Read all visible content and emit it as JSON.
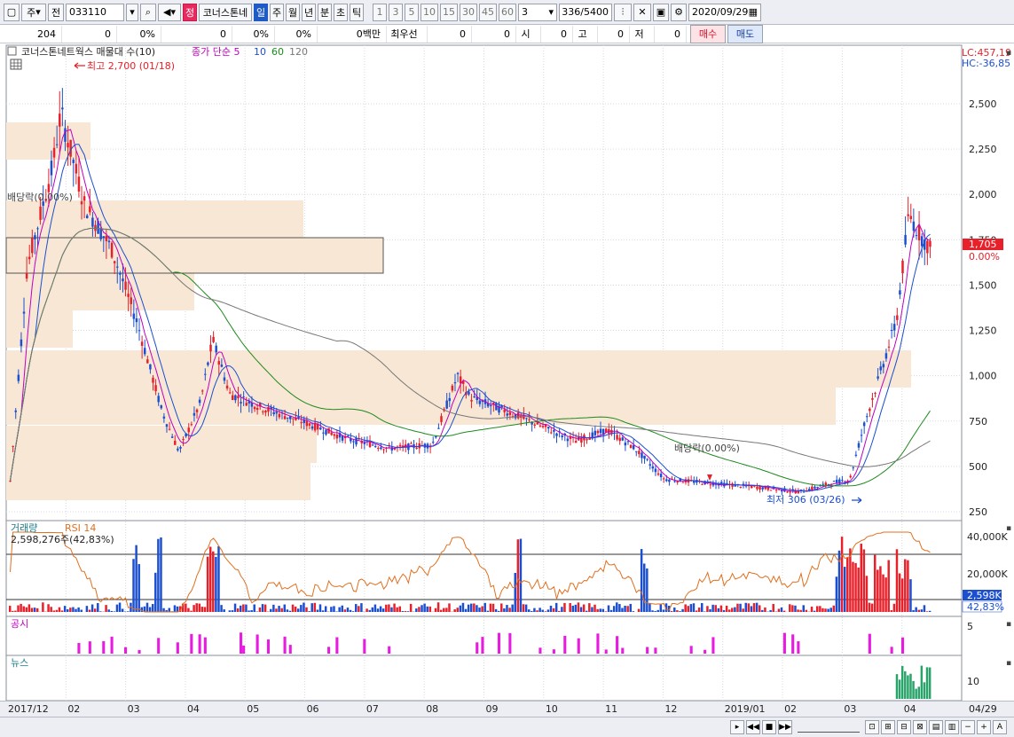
{
  "toolbar": {
    "type": "주",
    "prev": "전",
    "code": "033110",
    "jeong": "정",
    "stock_name": "코너스톤네",
    "periods": [
      "일",
      "주",
      "월",
      "년",
      "분",
      "초",
      "틱"
    ],
    "numbers": [
      "1",
      "3",
      "5",
      "10",
      "15",
      "30",
      "45",
      "60"
    ],
    "interval": "3",
    "count": "336",
    "total": "/5400",
    "date": "2020/09/29"
  },
  "quote": {
    "volume": "204",
    "v2": "0",
    "pct1": "0%",
    "v3": "0",
    "pct2": "0%",
    "pct3": "0%",
    "amount": "0백만",
    "best_label": "최우선",
    "best1": "0",
    "best2": "0",
    "open_label": "시",
    "open": "0",
    "high_label": "고",
    "high": "0",
    "low_label": "저",
    "low": "0",
    "buy": "매수",
    "sell": "매도"
  },
  "legend": {
    "title": "코너스톤네트웍스 매물대 수(10)",
    "ma_label": "종가 단순",
    "ma5": "5",
    "ma10": "10",
    "ma60": "60",
    "ma120": "120"
  },
  "right_info": {
    "lc": "LC:457,19",
    "hc": "HC:-36,85"
  },
  "annotations": {
    "high": "최고 2,700 (01/18)",
    "low": "최저 306 (03/26)",
    "dividend1": "배당락(0.00%)",
    "dividend2": "배당락(0.00%)"
  },
  "price_axis": [
    "2,500",
    "2,250",
    "2,000",
    "1,750",
    "1,500",
    "1,250",
    "1,000",
    "750",
    "500",
    "250"
  ],
  "current": {
    "price": "1,705",
    "change": "0.00%"
  },
  "volume_panel": {
    "title": "거래량",
    "rsi": "RSI 14",
    "value": "2,598,276주(42,83%)",
    "axis": [
      "40,000K",
      "20,000K"
    ],
    "cur_vol": "2,598K",
    "cur_rsi": "42,83%"
  },
  "disclosure": {
    "title": "공시",
    "axis": "5"
  },
  "news": {
    "title": "뉴스",
    "axis": "10"
  },
  "x_axis": [
    "2017/12",
    "02",
    "03",
    "04",
    "05",
    "06",
    "07",
    "08",
    "09",
    "10",
    "11",
    "12",
    "2019/01",
    "02",
    "03",
    "04",
    "04/29"
  ],
  "colors": {
    "up": "#e8202a",
    "down": "#1b4fd0",
    "ma5": "#c000c0",
    "ma10": "#1b4fd0",
    "ma60": "#1d8a1d",
    "ma120": "#777777",
    "profile": "#f7e7d4"
  }
}
